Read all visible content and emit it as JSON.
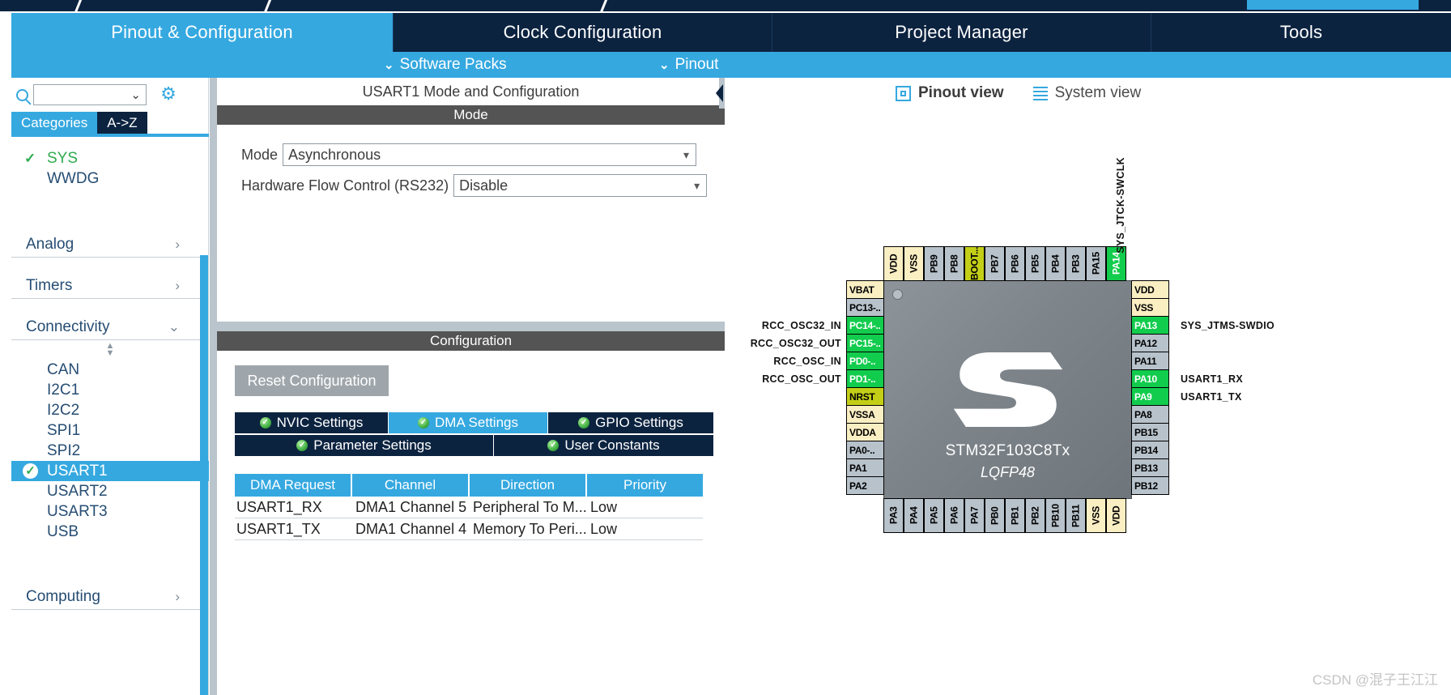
{
  "tabs": [
    {
      "label": "Pinout & Configuration",
      "active": true
    },
    {
      "label": "Clock Configuration",
      "active": false
    },
    {
      "label": "Project Manager",
      "active": false
    },
    {
      "label": "Tools",
      "active": false
    }
  ],
  "subbar": {
    "software_packs": "Software Packs",
    "pinout": "Pinout",
    "chevron": "⌄"
  },
  "sidebar": {
    "search_value": "",
    "search_chevron": "⌄",
    "gear_icon": "⚙",
    "tab_categories": "Categories",
    "tab_az": "A->Z",
    "top_items": [
      {
        "label": "SYS",
        "checked": true
      },
      {
        "label": "WWDG",
        "checked": false
      }
    ],
    "groups": [
      {
        "label": "Analog",
        "expanded": false,
        "arrow": "›"
      },
      {
        "label": "Timers",
        "expanded": false,
        "arrow": "›"
      },
      {
        "label": "Connectivity",
        "expanded": true,
        "arrow": "⌄"
      }
    ],
    "connectivity_items": [
      {
        "label": "CAN",
        "selected": false,
        "configured": false
      },
      {
        "label": "I2C1",
        "selected": false,
        "configured": false
      },
      {
        "label": "I2C2",
        "selected": false,
        "configured": false
      },
      {
        "label": "SPI1",
        "selected": false,
        "configured": false
      },
      {
        "label": "SPI2",
        "selected": false,
        "configured": false
      },
      {
        "label": "USART1",
        "selected": true,
        "configured": true
      },
      {
        "label": "USART2",
        "selected": false,
        "configured": false
      },
      {
        "label": "USART3",
        "selected": false,
        "configured": false
      },
      {
        "label": "USB",
        "selected": false,
        "configured": false
      }
    ],
    "bottom_group": {
      "label": "Computing",
      "arrow": "›"
    }
  },
  "middle": {
    "panel_title": "USART1 Mode and Configuration",
    "mode_header": "Mode",
    "mode_label": "Mode",
    "mode_value": "Asynchronous",
    "hfc_label": "Hardware Flow Control (RS232)",
    "hfc_value": "Disable",
    "configuration_header": "Configuration",
    "reset_button": "Reset Configuration",
    "config_tabs": [
      {
        "label": "NVIC Settings",
        "active": false
      },
      {
        "label": "DMA Settings",
        "active": true
      },
      {
        "label": "GPIO Settings",
        "active": false
      },
      {
        "label": "Parameter Settings",
        "active": false
      },
      {
        "label": "User Constants",
        "active": false
      }
    ],
    "dma_table": {
      "columns": [
        "DMA Request",
        "Channel",
        "Direction",
        "Priority"
      ],
      "rows": [
        [
          "USART1_RX",
          "DMA1 Channel 5",
          "Peripheral To M...",
          "Low"
        ],
        [
          "USART1_TX",
          "DMA1 Channel 4",
          "Memory To Peri...",
          "Low"
        ]
      ]
    }
  },
  "right": {
    "view_pinout": "Pinout view",
    "view_system": "System view",
    "chip_name": "STM32F103C8Tx",
    "chip_package": "LQFP48",
    "watermark": "CSDN @混子王江江",
    "top_pins": [
      {
        "label": "VDD",
        "type": "power"
      },
      {
        "label": "VSS",
        "type": "power"
      },
      {
        "label": "PB9",
        "type": "normal"
      },
      {
        "label": "PB8",
        "type": "normal"
      },
      {
        "label": "BOOT...",
        "type": "boot"
      },
      {
        "label": "PB7",
        "type": "normal"
      },
      {
        "label": "PB6",
        "type": "normal"
      },
      {
        "label": "PB5",
        "type": "normal"
      },
      {
        "label": "PB4",
        "type": "normal"
      },
      {
        "label": "PB3",
        "type": "normal"
      },
      {
        "label": "PA15",
        "type": "normal"
      },
      {
        "label": "PA14",
        "type": "green"
      }
    ],
    "top_signals": [
      {
        "pin": "PA14",
        "label": "SYS_JTCK-SWCLK"
      }
    ],
    "left_pins": [
      {
        "label": "VBAT",
        "type": "power",
        "signal": ""
      },
      {
        "label": "PC13-..",
        "type": "normal",
        "signal": ""
      },
      {
        "label": "PC14-..",
        "type": "green",
        "signal": "RCC_OSC32_IN"
      },
      {
        "label": "PC15-..",
        "type": "green",
        "signal": "RCC_OSC32_OUT"
      },
      {
        "label": "PD0-..",
        "type": "green",
        "signal": "RCC_OSC_IN"
      },
      {
        "label": "PD1-..",
        "type": "green",
        "signal": "RCC_OSC_OUT"
      },
      {
        "label": "NRST",
        "type": "boot",
        "signal": ""
      },
      {
        "label": "VSSA",
        "type": "power",
        "signal": ""
      },
      {
        "label": "VDDA",
        "type": "power",
        "signal": ""
      },
      {
        "label": "PA0-..",
        "type": "normal",
        "signal": ""
      },
      {
        "label": "PA1",
        "type": "normal",
        "signal": ""
      },
      {
        "label": "PA2",
        "type": "normal",
        "signal": ""
      }
    ],
    "right_pins": [
      {
        "label": "VDD",
        "type": "power",
        "signal": ""
      },
      {
        "label": "VSS",
        "type": "power",
        "signal": ""
      },
      {
        "label": "PA13",
        "type": "green",
        "signal": "SYS_JTMS-SWDIO"
      },
      {
        "label": "PA12",
        "type": "normal",
        "signal": ""
      },
      {
        "label": "PA11",
        "type": "normal",
        "signal": ""
      },
      {
        "label": "PA10",
        "type": "green",
        "signal": "USART1_RX"
      },
      {
        "label": "PA9",
        "type": "green",
        "signal": "USART1_TX"
      },
      {
        "label": "PA8",
        "type": "normal",
        "signal": ""
      },
      {
        "label": "PB15",
        "type": "normal",
        "signal": ""
      },
      {
        "label": "PB14",
        "type": "normal",
        "signal": ""
      },
      {
        "label": "PB13",
        "type": "normal",
        "signal": ""
      },
      {
        "label": "PB12",
        "type": "normal",
        "signal": ""
      }
    ],
    "bottom_pins": [
      {
        "label": "PA3",
        "type": "normal"
      },
      {
        "label": "PA4",
        "type": "normal"
      },
      {
        "label": "PA5",
        "type": "normal"
      },
      {
        "label": "PA6",
        "type": "normal"
      },
      {
        "label": "PA7",
        "type": "normal"
      },
      {
        "label": "PB0",
        "type": "normal"
      },
      {
        "label": "PB1",
        "type": "normal"
      },
      {
        "label": "PB2",
        "type": "normal"
      },
      {
        "label": "PB10",
        "type": "normal"
      },
      {
        "label": "PB11",
        "type": "normal"
      },
      {
        "label": "VSS",
        "type": "power"
      },
      {
        "label": "VDD",
        "type": "power"
      }
    ]
  },
  "colors": {
    "accent": "#35a8e0",
    "dark_navy": "#0c2340",
    "green_pin": "#12cc4d",
    "power_pin": "#faeec3",
    "boot_pin": "#c3cf17",
    "gray_pin": "#b7c2cb"
  }
}
